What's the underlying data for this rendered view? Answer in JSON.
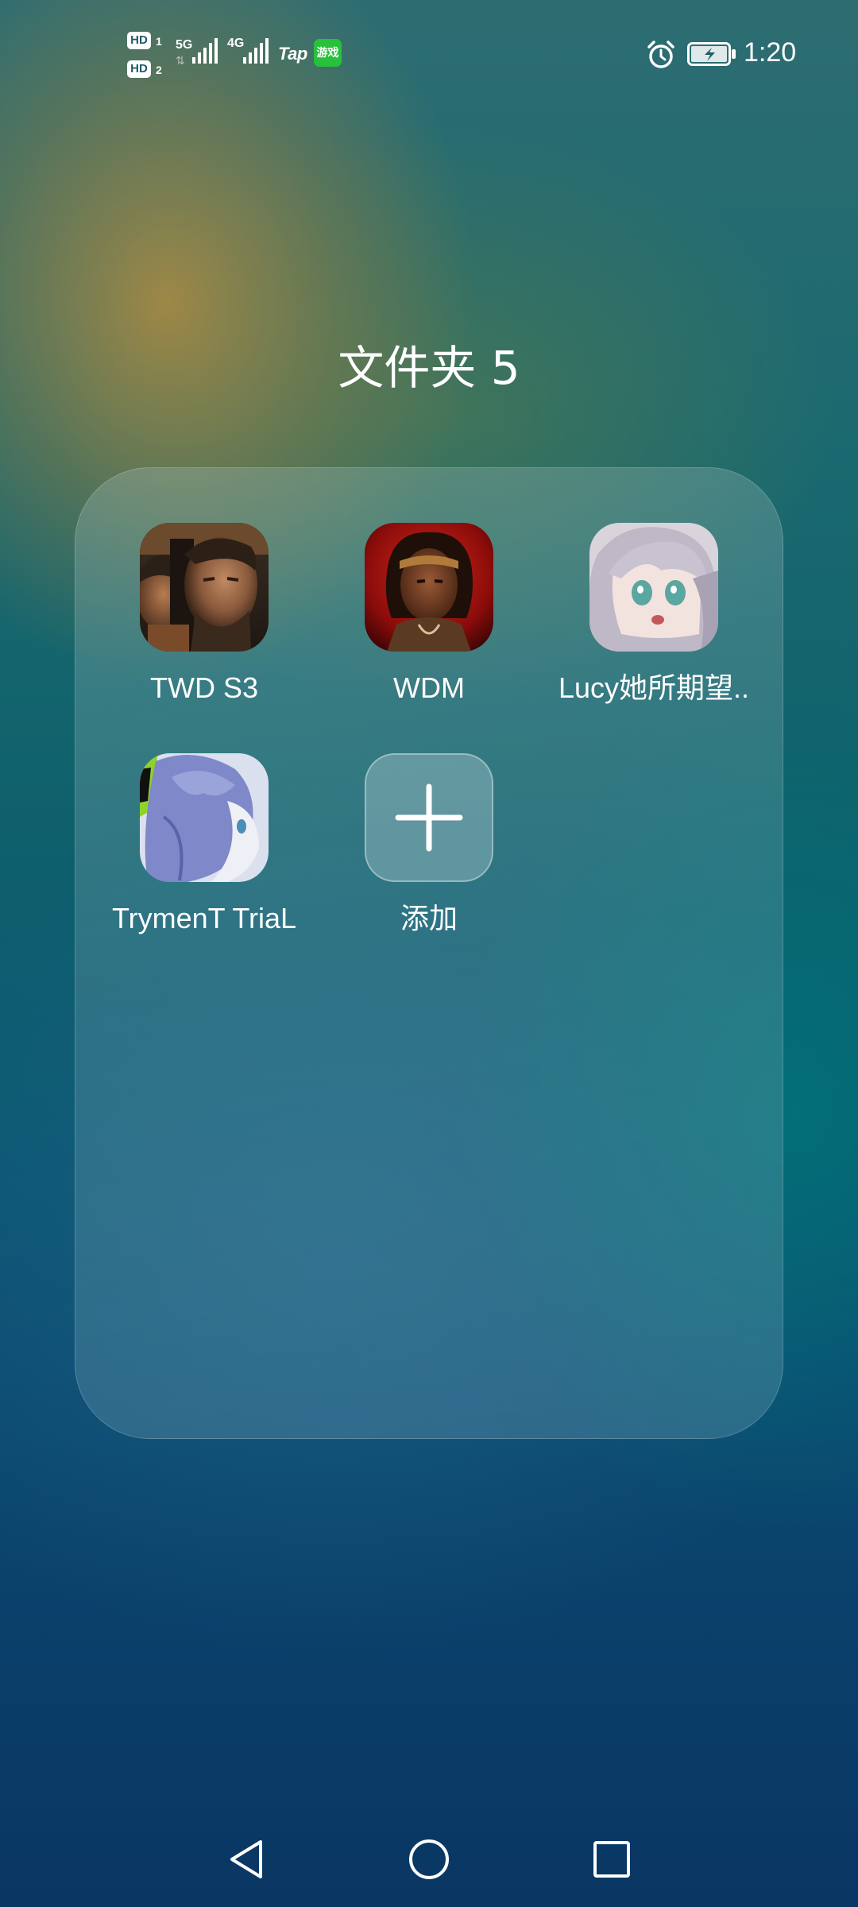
{
  "status_bar": {
    "sim1_badge": "HD",
    "sim1_num": "1",
    "sim2_badge": "HD",
    "sim2_num": "2",
    "network_1": "5G",
    "network_2": "4G",
    "tap_label": "Tap",
    "game_badge_text": "游戏",
    "time": "1:20",
    "icons": [
      "signal-icon",
      "signal-icon",
      "alarm-icon",
      "battery-charging-icon"
    ]
  },
  "folder": {
    "title": "文件夹 5",
    "apps": [
      {
        "label": "TWD S3",
        "icon": "twd-s3-app-icon"
      },
      {
        "label": "WDM",
        "icon": "wdm-app-icon"
      },
      {
        "label": "Lucy她所期望..",
        "icon": "lucy-app-icon"
      },
      {
        "label": "TrymenT TriaL",
        "icon": "trryment-trial-app-icon"
      },
      {
        "label": "添加",
        "icon": "plus-icon"
      }
    ]
  },
  "nav_bar": {
    "icons": [
      "back-triangle-icon",
      "home-circle-icon",
      "recents-square-icon"
    ]
  },
  "colors": {
    "game_badge": "#27c13c",
    "text": "#ffffff"
  }
}
